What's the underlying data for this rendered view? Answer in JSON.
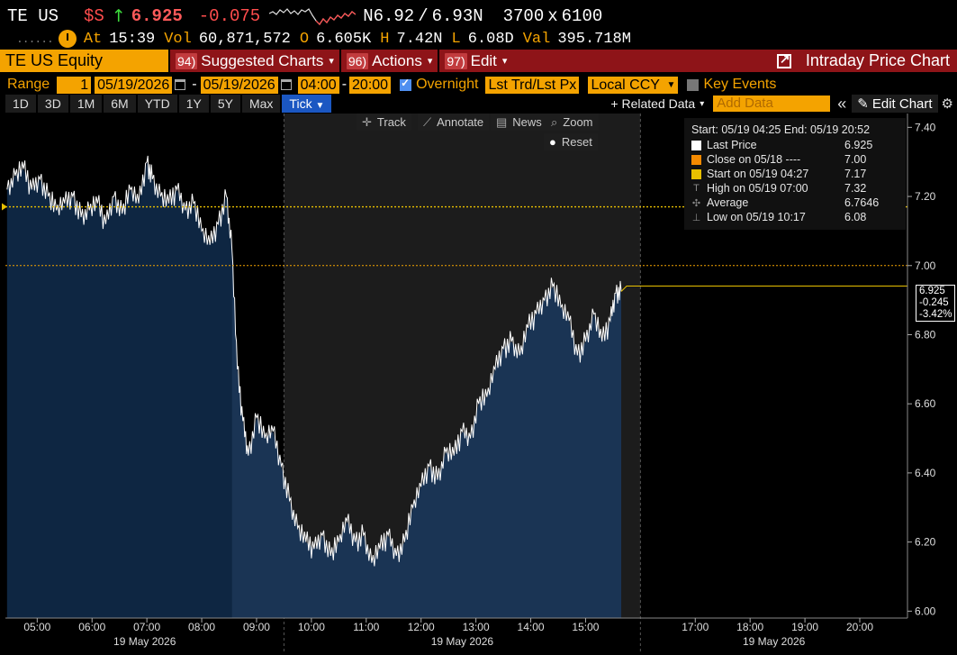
{
  "quote": {
    "ticker": "TE US",
    "currency_symbol": "$S",
    "direction_arrow": "↑",
    "last_price": "6.925",
    "change": "-0.075",
    "bid": "N6.92",
    "slash": "/",
    "ask": "6.93N",
    "bid_size": "3700",
    "size_x": "x",
    "ask_size": "6100"
  },
  "stats": {
    "dots": "......",
    "at_label": "At",
    "time": "15:39",
    "vol_label": "Vol",
    "volume": "60,871,572",
    "open_label": "O",
    "open": "6.605K",
    "high_label": "H",
    "high": "7.42N",
    "low_label": "L",
    "low": "6.08D",
    "val_label": "Val",
    "value": "395.718M"
  },
  "menubar": {
    "security": "TE US Equity",
    "items": [
      {
        "num": "94)",
        "label": "Suggested Charts",
        "arrow": "▾"
      },
      {
        "num": "96)",
        "label": "Actions",
        "arrow": "▾"
      },
      {
        "num": "97)",
        "label": "Edit",
        "arrow": "▾"
      }
    ],
    "title": "Intraday Price Chart"
  },
  "range_bar": {
    "range_label": "Range",
    "range_value": "1",
    "start_date": "05/19/2026",
    "dash1": "-",
    "end_date": "05/19/2026",
    "start_time": "04:00",
    "dash2": "-",
    "end_time": "20:00",
    "overnight_label": "Overnight",
    "price_type": "Lst Trd/Lst Px",
    "currency": "Local CCY",
    "key_events_label": "Key Events"
  },
  "period_bar": {
    "periods": [
      "1D",
      "3D",
      "1M",
      "6M",
      "YTD",
      "1Y",
      "5Y",
      "Max"
    ],
    "active": "Tick",
    "active_arrow": "▼",
    "related_data": "+ Related Data",
    "related_arrow": "▾",
    "add_data_placeholder": "Add Data",
    "collapse": "«",
    "edit_chart": "Edit Chart",
    "gear": "⚙"
  },
  "tools": {
    "track": "Track",
    "annotate": "Annotate",
    "news": "News",
    "zoom": "Zoom",
    "reset": "Reset"
  },
  "legend": {
    "header": "Start: 05/19 04:25 End: 05/19 20:52",
    "rows": [
      {
        "label": "Last Price",
        "value": "6.925",
        "color": "#ffffff"
      },
      {
        "label": "Close on 05/18 ----",
        "value": "7.00",
        "color": "#f48a00"
      },
      {
        "label": "Start on 05/19 04:27",
        "value": "7.17",
        "color": "#e8c000"
      },
      {
        "label": "High on 05/19 07:00",
        "value": "7.32",
        "sym": "T"
      },
      {
        "label": "Average",
        "value": "6.7646",
        "sym": "✣"
      },
      {
        "label": "Low on 05/19 10:17",
        "value": "6.08",
        "sym": "⊥"
      }
    ]
  },
  "price_labels": {
    "last": "6.925",
    "change": "-0.245",
    "pct": "-3.42%"
  },
  "colors": {
    "accent": "#f4a300",
    "menu_red": "#8e1418",
    "active_tab": "#1b57c2",
    "premarket_area": "#0e2642",
    "session_area": "#1a3454",
    "prev_close_line": "#f4a300",
    "start_line": "#e8c000"
  },
  "chart_data": {
    "type": "area",
    "ylim": [
      5.98,
      7.44
    ],
    "xlim_hours": [
      4.42,
      20.87
    ],
    "y_ticks": [
      "7.40",
      "7.20",
      "7.00",
      "6.80",
      "6.60",
      "6.40",
      "6.20",
      "6.00"
    ],
    "x_ticks": [
      "05:00",
      "06:00",
      "07:00",
      "08:00",
      "09:00",
      "10:00",
      "11:00",
      "12:00",
      "13:00",
      "14:00",
      "15:00",
      "17:00",
      "18:00",
      "19:00",
      "20:00"
    ],
    "x_tick_hours": [
      5,
      6,
      7,
      8,
      9,
      10,
      11,
      12,
      13,
      14,
      15,
      17,
      18,
      19,
      20
    ],
    "date_labels": [
      "19 May 2026",
      "19 May 2026",
      "19 May 2026"
    ],
    "session_open_hour": 9.5,
    "session_close_hour": 16.0,
    "last_trade_hour": 15.65,
    "prev_close": 7.0,
    "start_price": 7.17,
    "last_price": 6.925,
    "series": [
      {
        "x": [
          4.45,
          4.6,
          4.75,
          4.9,
          5.05,
          5.2,
          5.35,
          5.5,
          5.65,
          5.8,
          5.95,
          6.1,
          6.25,
          6.4,
          6.55,
          6.7,
          6.85,
          7.0,
          7.1,
          7.25,
          7.4,
          7.55,
          7.7,
          7.85,
          8.0,
          8.15,
          8.3,
          8.45,
          8.55,
          8.65,
          8.75,
          8.85,
          9.0,
          9.15,
          9.3,
          9.45,
          9.6,
          9.75,
          9.9,
          10.05,
          10.2,
          10.35,
          10.5,
          10.65,
          10.8,
          10.95,
          11.1,
          11.25,
          11.4,
          11.55,
          11.7,
          11.85,
          12.0,
          12.15,
          12.3,
          12.45,
          12.6,
          12.75,
          12.9,
          13.05,
          13.2,
          13.35,
          13.5,
          13.65,
          13.8,
          13.95,
          14.1,
          14.25,
          14.4,
          14.55,
          14.7,
          14.85,
          15.0,
          15.15,
          15.3,
          15.45,
          15.55,
          15.65
        ],
        "y": [
          7.22,
          7.26,
          7.28,
          7.22,
          7.25,
          7.2,
          7.16,
          7.18,
          7.2,
          7.14,
          7.16,
          7.18,
          7.12,
          7.2,
          7.15,
          7.22,
          7.18,
          7.3,
          7.25,
          7.2,
          7.18,
          7.22,
          7.16,
          7.18,
          7.1,
          7.06,
          7.12,
          7.2,
          7.05,
          6.7,
          6.55,
          6.45,
          6.56,
          6.5,
          6.52,
          6.42,
          6.32,
          6.24,
          6.2,
          6.18,
          6.22,
          6.16,
          6.2,
          6.26,
          6.2,
          6.22,
          6.14,
          6.18,
          6.22,
          6.16,
          6.2,
          6.3,
          6.36,
          6.42,
          6.38,
          6.46,
          6.45,
          6.52,
          6.5,
          6.6,
          6.62,
          6.7,
          6.76,
          6.78,
          6.74,
          6.82,
          6.86,
          6.9,
          6.94,
          6.88,
          6.84,
          6.74,
          6.78,
          6.86,
          6.78,
          6.84,
          6.92,
          6.925
        ]
      }
    ]
  }
}
